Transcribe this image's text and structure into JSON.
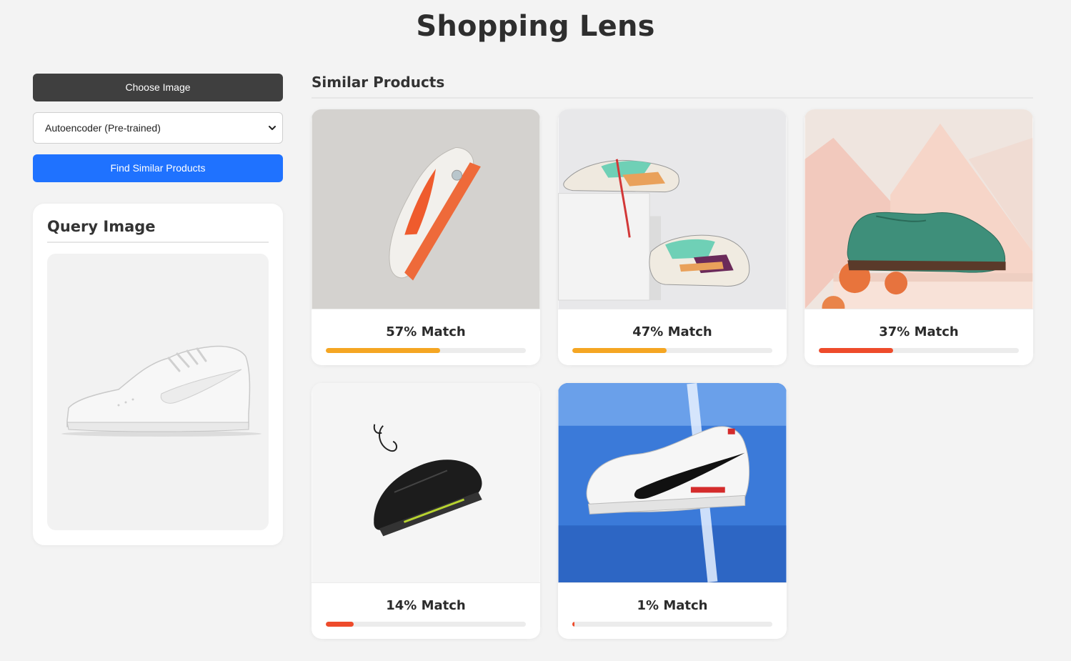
{
  "app": {
    "title": "Shopping Lens"
  },
  "controls": {
    "choose_label": "Choose Image",
    "model_selected": "Autoencoder (Pre-trained)",
    "find_label": "Find Similar Products"
  },
  "query": {
    "title": "Query Image"
  },
  "results": {
    "title": "Similar Products",
    "items": [
      {
        "label": "57% Match",
        "match": 0.57,
        "bar_color": "#f5a623",
        "image": "grey-orange-running-sneaker"
      },
      {
        "label": "47% Match",
        "match": 0.47,
        "bar_color": "#f5a623",
        "image": "pair-of-multicolor-sneakers-on-pedestal"
      },
      {
        "label": "37% Match",
        "match": 0.37,
        "bar_color": "#ee4b2b",
        "image": "teal-suede-brogue-shoe"
      },
      {
        "label": "14% Match",
        "match": 0.14,
        "bar_color": "#ee4b2b",
        "image": "black-knit-running-shoe"
      },
      {
        "label": "1% Match",
        "match": 0.01,
        "bar_color": "#ee4b2b",
        "image": "white-nike-air-sneaker-on-blue"
      }
    ]
  },
  "colors": {
    "accent": "#1f72ff",
    "dark_button": "#3f3f3f",
    "background": "#f3f3f3"
  }
}
